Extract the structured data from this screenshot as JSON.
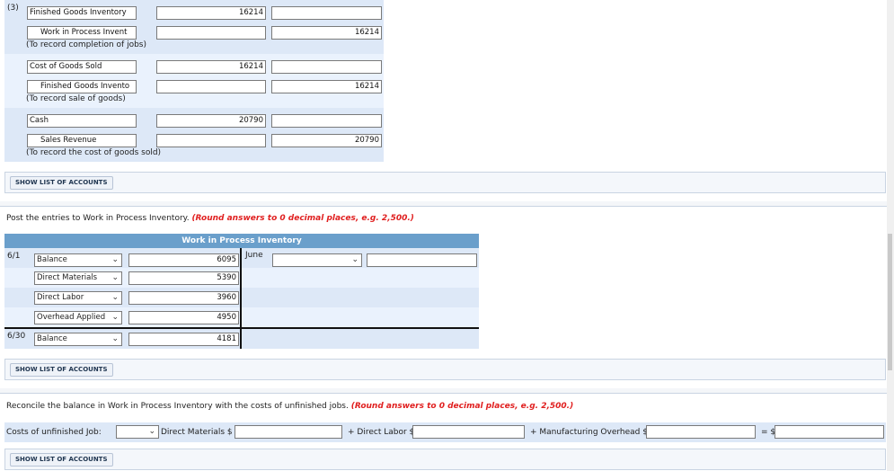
{
  "journal": {
    "part_label": "(3)",
    "entries": [
      {
        "debit_account": "Finished Goods Inventory",
        "debit_amount": "16214",
        "credit_account": "Work in Process Invent",
        "credit_amount": "16214",
        "memo": "(To record completion of jobs)"
      },
      {
        "debit_account": "Cost of Goods Sold",
        "debit_amount": "16214",
        "credit_account": "Finished Goods Invento",
        "credit_amount": "16214",
        "memo": "(To record sale of goods)"
      },
      {
        "debit_account": "Cash",
        "debit_amount": "20790",
        "credit_account": "Sales Revenue",
        "credit_amount": "20790",
        "memo": "(To record the cost of goods sold)"
      }
    ]
  },
  "show_accounts_label": "SHOW LIST OF ACCOUNTS",
  "post_section": {
    "instruction": "Post the entries to Work in Process Inventory.",
    "hint": "(Round answers to 0 decimal places, e.g. 2,500.)",
    "t_account": {
      "title": "Work in Process Inventory",
      "debit_rows": [
        {
          "date": "6/1",
          "account": "Balance",
          "amount": "6095"
        },
        {
          "date": "",
          "account": "Direct Materials",
          "amount": "5390"
        },
        {
          "date": "",
          "account": "Direct Labor",
          "amount": "3960"
        },
        {
          "date": "",
          "account": "Overhead Applied",
          "amount": "4950"
        }
      ],
      "ending": {
        "date": "6/30",
        "account": "Balance",
        "amount": "4181"
      },
      "credit_row": {
        "date": "June",
        "account": "",
        "amount": ""
      }
    }
  },
  "reconcile_section": {
    "instruction": "Reconcile the balance in Work in Process Inventory with the costs of unfinished jobs.",
    "hint": "(Round answers to 0 decimal places, e.g. 2,500.)",
    "job_label": "Costs of unfinished Job:",
    "job_value": "",
    "dm_label": "Direct Materials $",
    "dm_value": "",
    "dl_label": "+ Direct Labor $",
    "dl_value": "",
    "moh_label": "+ Manufacturing Overhead $",
    "moh_value": "",
    "total_label": "= $",
    "total_value": ""
  }
}
